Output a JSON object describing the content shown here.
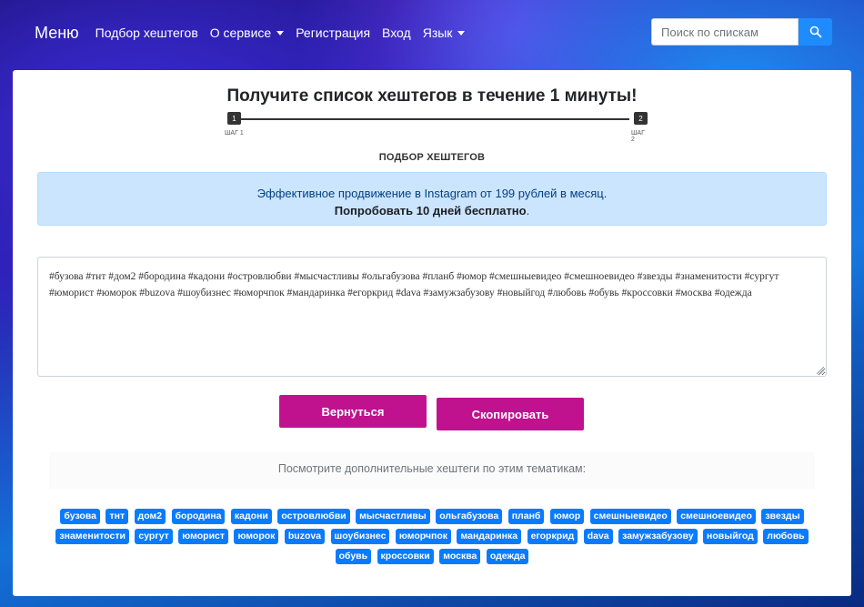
{
  "nav": {
    "brand": "Меню",
    "links": [
      {
        "label": "Подбор хештегов",
        "dropdown": false
      },
      {
        "label": "О сервисе",
        "dropdown": true
      },
      {
        "label": "Регистрация",
        "dropdown": false
      },
      {
        "label": "Вход",
        "dropdown": false
      },
      {
        "label": "Язык",
        "dropdown": true
      }
    ],
    "search_placeholder": "Поиск по спискам",
    "search_icon": "search-icon"
  },
  "main": {
    "title": "Получите список хештегов в течение 1 минуты!",
    "steps": [
      {
        "number": "1",
        "label": "ШАГ 1"
      },
      {
        "number": "2",
        "label": "ШАГ 2"
      }
    ],
    "section_heading": "ПОДБОР ХЕШТЕГОВ",
    "alert_line1": "Эффективное продвижение в Instagram от 199 рублей в месяц.",
    "alert_line2_bold": "Попробовать 10 дней бесплатно",
    "alert_line2_suffix": ".",
    "hashtag_text": "#бузова #тнт #дом2 #бородина #кадони #островлюбви #мысчастливы #ольгабузова #планб #юмор #смешныевидео #смешноевидео #звезды #знаменитости #сургут #юморист #юморок #buzova #шоубизнес #юморчпок #мандаринка #егоркрид #dava #замужзабузову #новыйгод #любовь #обувь #кроссовки #москва #одежда",
    "back_button": "Вернуться",
    "copy_button": "Скопировать",
    "more_text": "Посмотрите дополнительные хештеги по этим тематикам:",
    "tags": [
      "бузова",
      "тнт",
      "дом2",
      "бородина",
      "кадони",
      "островлюбви",
      "мысчастливы",
      "ольгабузова",
      "планб",
      "юмор",
      "смешныевидео",
      "смешноевидео",
      "звезды",
      "знаменитости",
      "сургут",
      "юморист",
      "юморок",
      "buzova",
      "шоубизнес",
      "юморчпок",
      "мандаринка",
      "егоркрид",
      "dava",
      "замужзабузову",
      "новыйгод",
      "любовь",
      "обувь",
      "кроссовки",
      "москва",
      "одежда"
    ]
  },
  "colors": {
    "accent_button": "#c0128f",
    "tag_blue": "#0a7bff",
    "search_button": "#1e8cff",
    "alert_bg": "#cce5ff"
  }
}
